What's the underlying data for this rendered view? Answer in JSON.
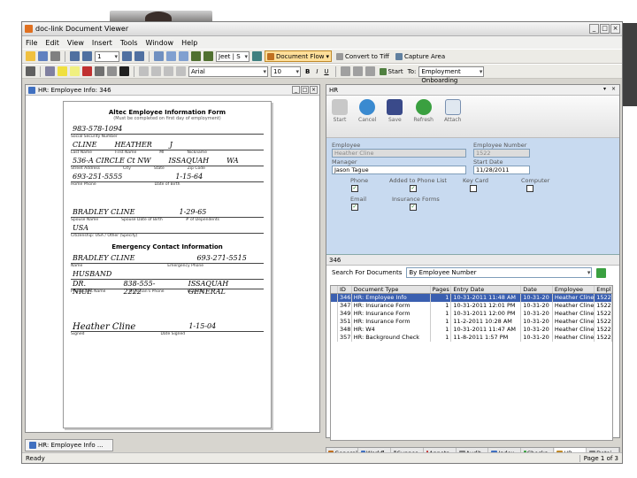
{
  "app": {
    "title": "doc-link Document Viewer"
  },
  "menu": [
    "File",
    "Edit",
    "View",
    "Insert",
    "Tools",
    "Window",
    "Help"
  ],
  "toolbar": {
    "page_input": "1",
    "combo1": "Jeet | S",
    "document_flow": "Document Flow",
    "convert": "Convert to Tiff",
    "capture": "Capture Area",
    "font_combo": "Arial",
    "size_combo": "10",
    "start": "Start",
    "to_label": "To:",
    "to_value": "Employment Onboarding"
  },
  "left_pane": {
    "title": "HR: Employee Info: 346",
    "tab_label": "HR: Employee Info ..."
  },
  "form": {
    "title": "Altec Employee Information Form",
    "subtitle": "(Must be completed on first day of employment)",
    "ssn": "983-578-1094",
    "ssn_label": "Social Security Number",
    "last": "CLINE",
    "first": "HEATHER",
    "mi": "J",
    "name_labels": [
      "Last Name",
      "First Name",
      "MI",
      "Nickname"
    ],
    "address": "536-A CIRCLE Ct NW",
    "city": "ISSAQUAH",
    "state": "WA",
    "addr_labels": [
      "Street Address",
      "City",
      "State",
      "Zip Code"
    ],
    "phone": "693-251-5555",
    "birth": "1-15-64",
    "phone_labels": [
      "Home Phone",
      "Date of Birth"
    ],
    "spouse": "BRADLEY CLINE",
    "spouse_birth": "1-29-65",
    "spouse_labels": [
      "Spouse Name",
      "Spouse Date of Birth",
      "# of Dependents"
    ],
    "usa": "USA",
    "citizen_label": "Citizenship: USA / Other (Specify)",
    "emergency_title": "Emergency Contact Information",
    "em_name": "BRADLEY CLINE",
    "em_phone": "693-271-5515",
    "em_labels": [
      "Name",
      "Emergency Phone"
    ],
    "relationship": "HUSBAND",
    "physician": "DR. NICE",
    "ph_phone": "838-555-2222",
    "hospital": "ISSAQUAH GENERAL",
    "ph_labels": [
      "Physician's Name",
      "Physician's Phone",
      "Hospital"
    ],
    "sign": "Heather Cline",
    "sign_date": "1-15-04",
    "sign_labels": [
      "Signed",
      "Date Signed"
    ]
  },
  "status": {
    "left": "Ready",
    "right": "Page 1 of 3"
  },
  "hr": {
    "title": "HR",
    "buttons": [
      "Start",
      "Cancel",
      "Save",
      "Refresh",
      "Attach"
    ],
    "employee_label": "Employee",
    "employee": "Heather Cline",
    "empnum_label": "Employee Number",
    "empnum": "1522",
    "manager_label": "Manager",
    "manager": "Jason Tague",
    "start_label": "Start Date",
    "start": "11/28/2011",
    "checks": [
      {
        "label": "Phone",
        "checked": true
      },
      {
        "label": "Added to Phone List",
        "checked": true
      },
      {
        "label": "Key Card",
        "checked": false
      },
      {
        "label": "Computer",
        "checked": false
      },
      {
        "label": "Email",
        "checked": true
      },
      {
        "label": "Insurance Forms",
        "checked": true
      }
    ],
    "section": "346",
    "search_label": "Search For Documents",
    "search_value": "By Employee Number",
    "columns": [
      "",
      "ID",
      "Document Type",
      "Pages",
      "Entry Date",
      "Date",
      "Employee",
      "Employ"
    ],
    "rows": [
      [
        "",
        "346",
        "HR: Employee Info",
        "1",
        "10-31-2011 11:48 AM",
        "10-31-20",
        "Heather Cline",
        "1522"
      ],
      [
        "",
        "347",
        "HR: Insurance Form",
        "1",
        "10-31-2011 12:01 PM",
        "10-31-20",
        "Heather Cline",
        "1522"
      ],
      [
        "",
        "349",
        "HR: Insurance Form",
        "1",
        "10-31-2011 12:00 PM",
        "10-31-20",
        "Heather Cline",
        "1522"
      ],
      [
        "",
        "351",
        "HR: Insurance Form",
        "1",
        "11-2-2011 10:28 AM",
        "10-31-20",
        "Heather Cline",
        "1522"
      ],
      [
        "",
        "348",
        "HR: W4",
        "1",
        "10-31-2011 11:47 AM",
        "10-31-20",
        "Heather Cline",
        "1522"
      ],
      [
        "",
        "357",
        "HR: Background Check",
        "1",
        "11-8-2011 1:57 PM",
        "10-31-20",
        "Heather Cline",
        "1522"
      ]
    ],
    "tabs": [
      "General",
      "Workfl...",
      "Suppor...",
      "Annota...",
      "Audit...",
      "Index...",
      "Checks...",
      "HR",
      "Detai..."
    ],
    "active_tab": 7
  },
  "colors": {
    "selection": "#3a5fb0",
    "panel_blue": "#c8daf0",
    "checkmark": "#1a7a1a"
  }
}
